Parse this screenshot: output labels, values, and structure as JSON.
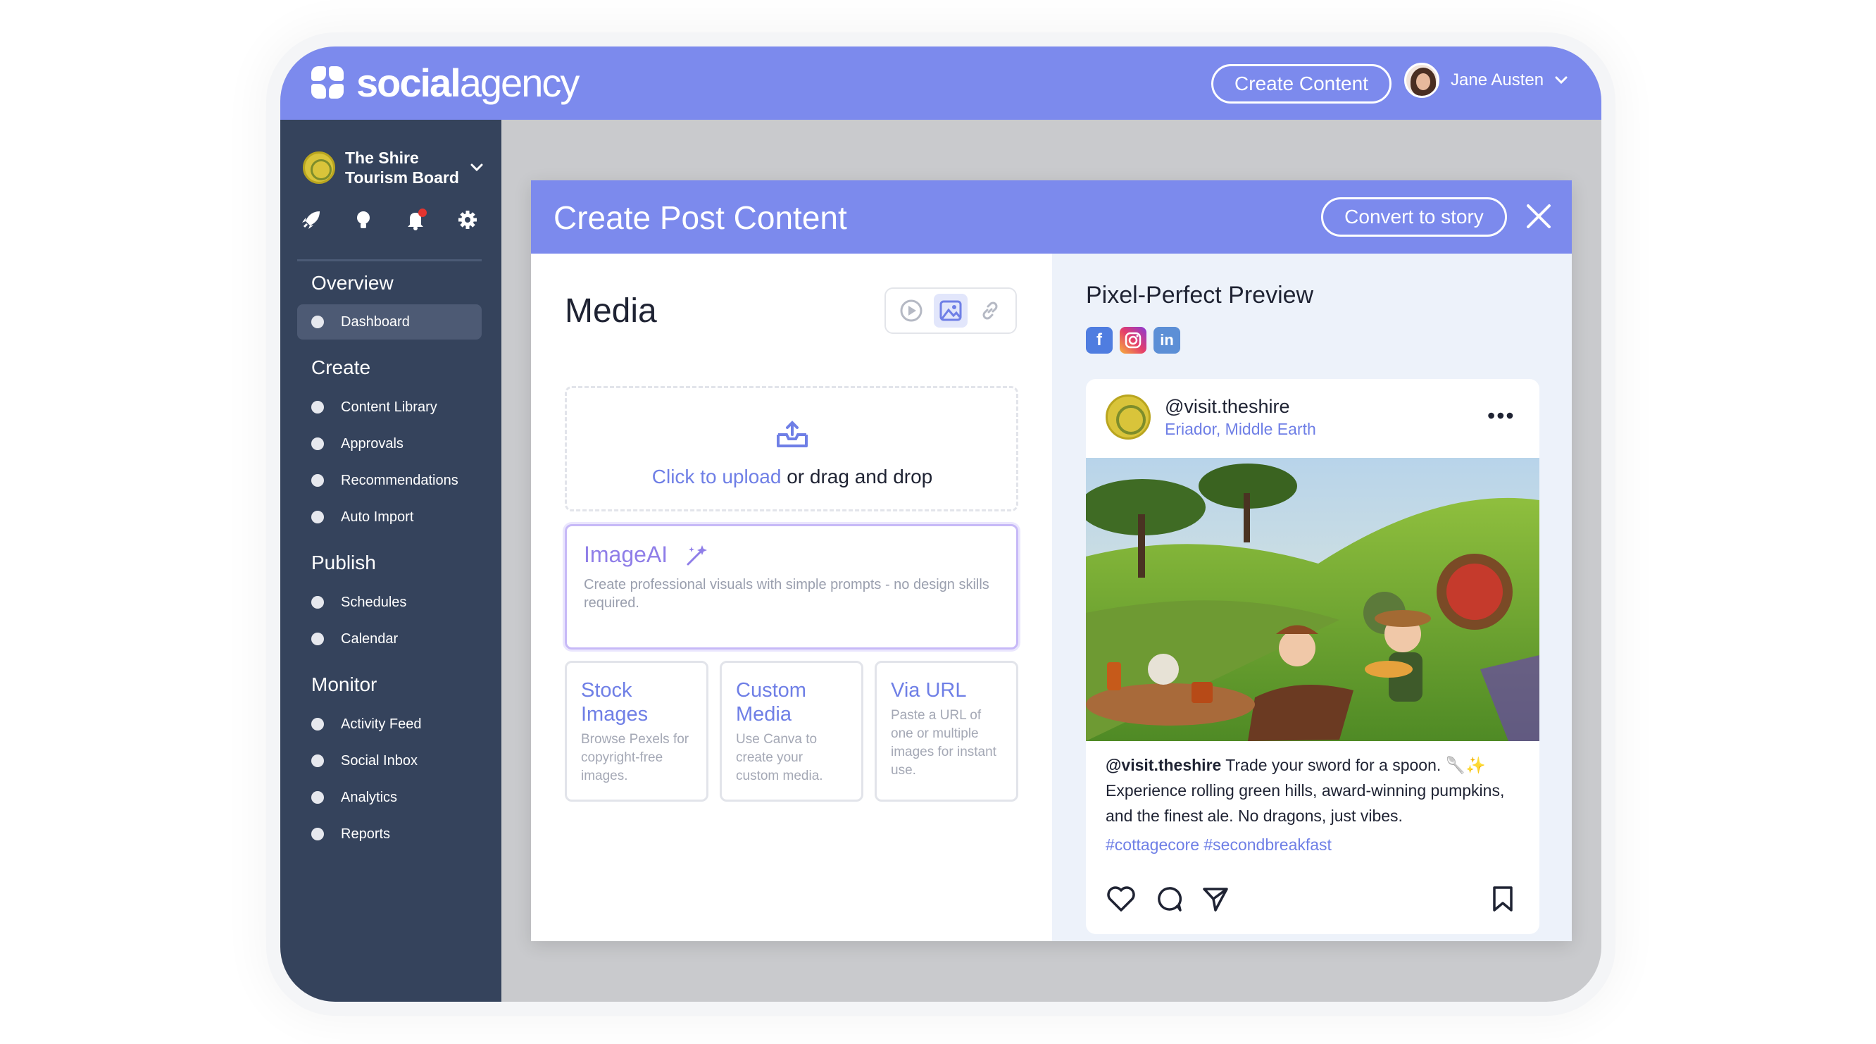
{
  "brand": {
    "name_bold": "social",
    "name_regular": "agency"
  },
  "header": {
    "create_button": "Create Content",
    "user_name": "Jane Austen"
  },
  "sidebar": {
    "org_name": "The Shire Tourism Board",
    "sections": [
      {
        "title": "Overview",
        "items": [
          {
            "label": "Dashboard",
            "active": true
          }
        ]
      },
      {
        "title": "Create",
        "items": [
          {
            "label": "Content Library"
          },
          {
            "label": "Approvals"
          },
          {
            "label": "Recommendations"
          },
          {
            "label": "Auto Import"
          }
        ]
      },
      {
        "title": "Publish",
        "items": [
          {
            "label": "Schedules"
          },
          {
            "label": "Calendar"
          }
        ]
      },
      {
        "title": "Monitor",
        "items": [
          {
            "label": "Activity Feed"
          },
          {
            "label": "Social Inbox"
          },
          {
            "label": "Analytics"
          },
          {
            "label": "Reports"
          }
        ]
      }
    ]
  },
  "modal": {
    "title": "Create Post Content",
    "convert_button": "Convert to story",
    "media": {
      "title": "Media",
      "upload_link": "Click to upload",
      "upload_rest": " or drag and drop",
      "imageai": {
        "title": "ImageAI",
        "description": "Create professional visuals with simple prompts - no design skills required."
      },
      "cards": [
        {
          "title": "Stock Images",
          "description": "Browse Pexels for copyright-free images."
        },
        {
          "title": "Custom Media",
          "description": "Use Canva to create your custom media."
        },
        {
          "title": "Via URL",
          "description": "Paste a URL of one or multiple images for instant use."
        }
      ]
    },
    "preview": {
      "title": "Pixel-Perfect Preview",
      "post": {
        "handle": "@visit.theshire",
        "location": "Eriador, Middle Earth",
        "caption_handle": "@visit.theshire",
        "caption": " Trade your sword for a spoon. 🥄✨ Experience rolling green hills, award-winning pumpkins, and the finest ale. No dragons, just vibes.",
        "hashtags": "#cottagecore #secondbreakfast"
      }
    }
  },
  "colors": {
    "accent": "#7c8aed",
    "sidebar": "#35435c",
    "link": "#6f7fe6"
  }
}
